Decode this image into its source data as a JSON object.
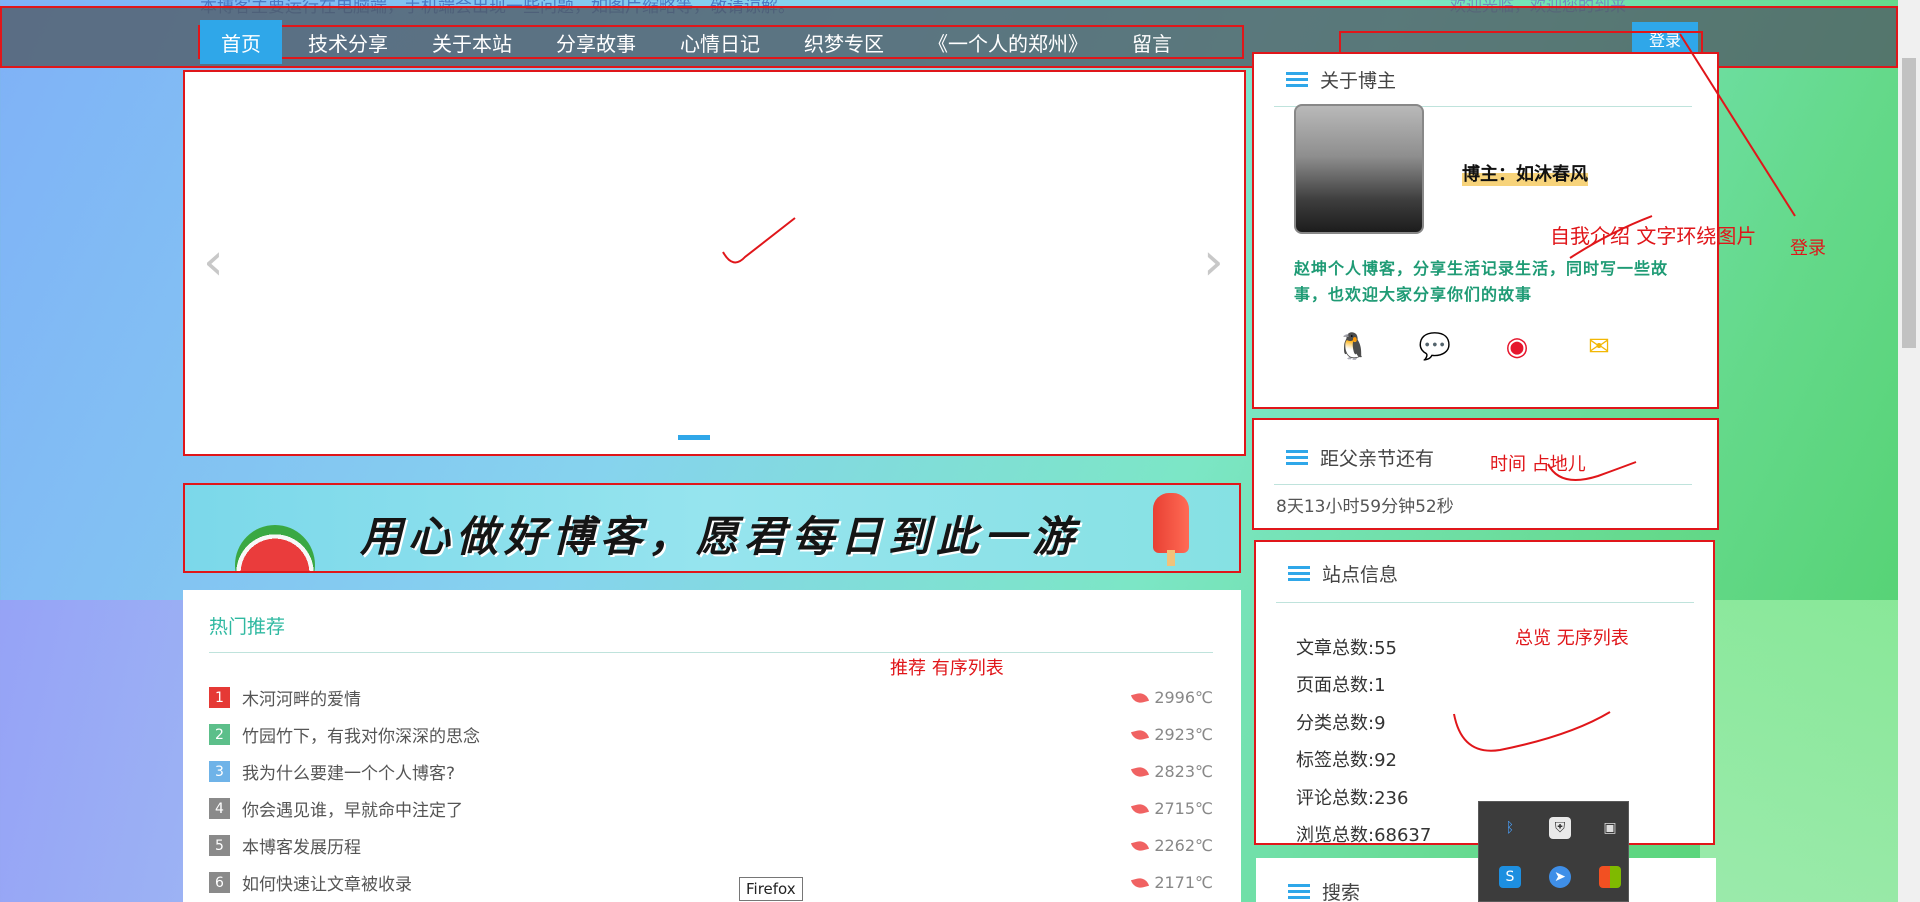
{
  "notice": {
    "left_text": "本博客主要运行在电脑端，手机端会出现一些问题，如图片缩略等，敬请谅解。",
    "right_text": "欢迎光临，欢迎您的到来"
  },
  "nav": {
    "items": [
      "首页",
      "技术分享",
      "关于本站",
      "分享故事",
      "心情日记",
      "织梦专区",
      "《一个人的郑州》",
      "留言"
    ],
    "login_label": "登录"
  },
  "slider": {
    "prev_icon": "‹",
    "next_icon": "›"
  },
  "banner": {
    "text": "用心做好博客，愿君每日到此一游"
  },
  "hot": {
    "title": "热门推荐",
    "items": [
      {
        "rank": "1",
        "title": "木河河畔的爱情",
        "temp": "2996℃",
        "color": "#e53935"
      },
      {
        "rank": "2",
        "title": "竹园竹下，有我对你深深的思念",
        "temp": "2923℃",
        "color": "#5cbf8a"
      },
      {
        "rank": "3",
        "title": "我为什么要建一个个人博客?",
        "temp": "2823℃",
        "color": "#6fb3e8"
      },
      {
        "rank": "4",
        "title": "你会遇见谁，早就命中注定了",
        "temp": "2715℃",
        "color": "#8a8a8a"
      },
      {
        "rank": "5",
        "title": "本博客发展历程",
        "temp": "2262℃",
        "color": "#8a8a8a"
      },
      {
        "rank": "6",
        "title": "如何快速让文章被收录",
        "temp": "2171℃",
        "color": "#8a8a8a"
      }
    ]
  },
  "about": {
    "title": "关于博主",
    "name": "博主：如沐春风",
    "intro": "赵坤个人博客，分享生活记录生活，同时写一些故事，也欢迎大家分享你们的故事"
  },
  "countdown": {
    "title": "距父亲节还有",
    "value": "8天13小时59分钟52秒"
  },
  "site_info": {
    "title": "站点信息",
    "stats": [
      "文章总数:55",
      "页面总数:1",
      "分类总数:9",
      "标签总数:92",
      "评论总数:236",
      "浏览总数:68637"
    ]
  },
  "search": {
    "title": "搜索"
  },
  "annotations": {
    "login": "登录",
    "intro": "自我介绍  文字环绕图片",
    "time": "时间  占地儿",
    "recommend": "推荐  有序列表",
    "overview": "总览  无序列表"
  },
  "tooltip": "Firefox",
  "colors": {
    "accent": "#2fa7e9",
    "annotation": "#e0161a",
    "hot_title": "#2fb9a1"
  }
}
